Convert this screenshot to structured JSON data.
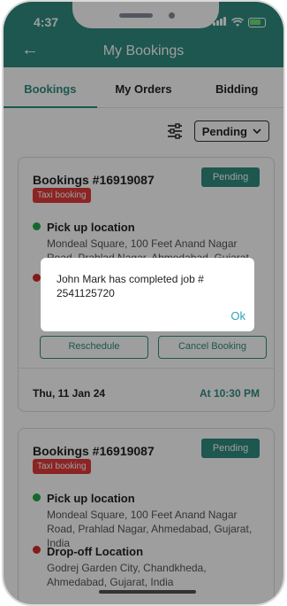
{
  "status_bar": {
    "time": "4:37"
  },
  "header": {
    "title": "My Bookings"
  },
  "tabs": [
    {
      "label": "Bookings",
      "active": true
    },
    {
      "label": "My Orders",
      "active": false
    },
    {
      "label": "Bidding",
      "active": false
    }
  ],
  "filter": {
    "selected": "Pending"
  },
  "bookings": [
    {
      "title": "Bookings #16919087",
      "status": "Pending",
      "tag": "Taxi booking",
      "pickup_label": "Pick up location",
      "pickup_address": "Mondeal Square, 100 Feet Anand Nagar Road, Prahlad Nagar, Ahmedabad, Gujarat, India",
      "reschedule_label": "Reschedule",
      "cancel_label": "Cancel Booking",
      "date": "Thu, 11 Jan 24",
      "time": "At 10:30 PM"
    },
    {
      "title": "Bookings #16919087",
      "status": "Pending",
      "tag": "Taxi booking",
      "pickup_label": "Pick up location",
      "pickup_address": "Mondeal Square, 100 Feet Anand Nagar Road, Prahlad Nagar, Ahmedabad, Gujarat, India",
      "dropoff_label": "Drop-off Location",
      "dropoff_address": "Godrej Garden City, Chandkheda, Ahmedabad, Gujarat, India"
    }
  ],
  "dialog": {
    "message": "John Mark has completed job # 2541125720",
    "ok_label": "Ok"
  },
  "colors": {
    "primary": "#2f8d80",
    "tag": "#e23b3b",
    "link": "#2fa3b8"
  },
  "icons": {
    "back": "back-arrow-icon",
    "filter": "filter-sliders-icon",
    "dropdown": "chevron-down-icon"
  }
}
